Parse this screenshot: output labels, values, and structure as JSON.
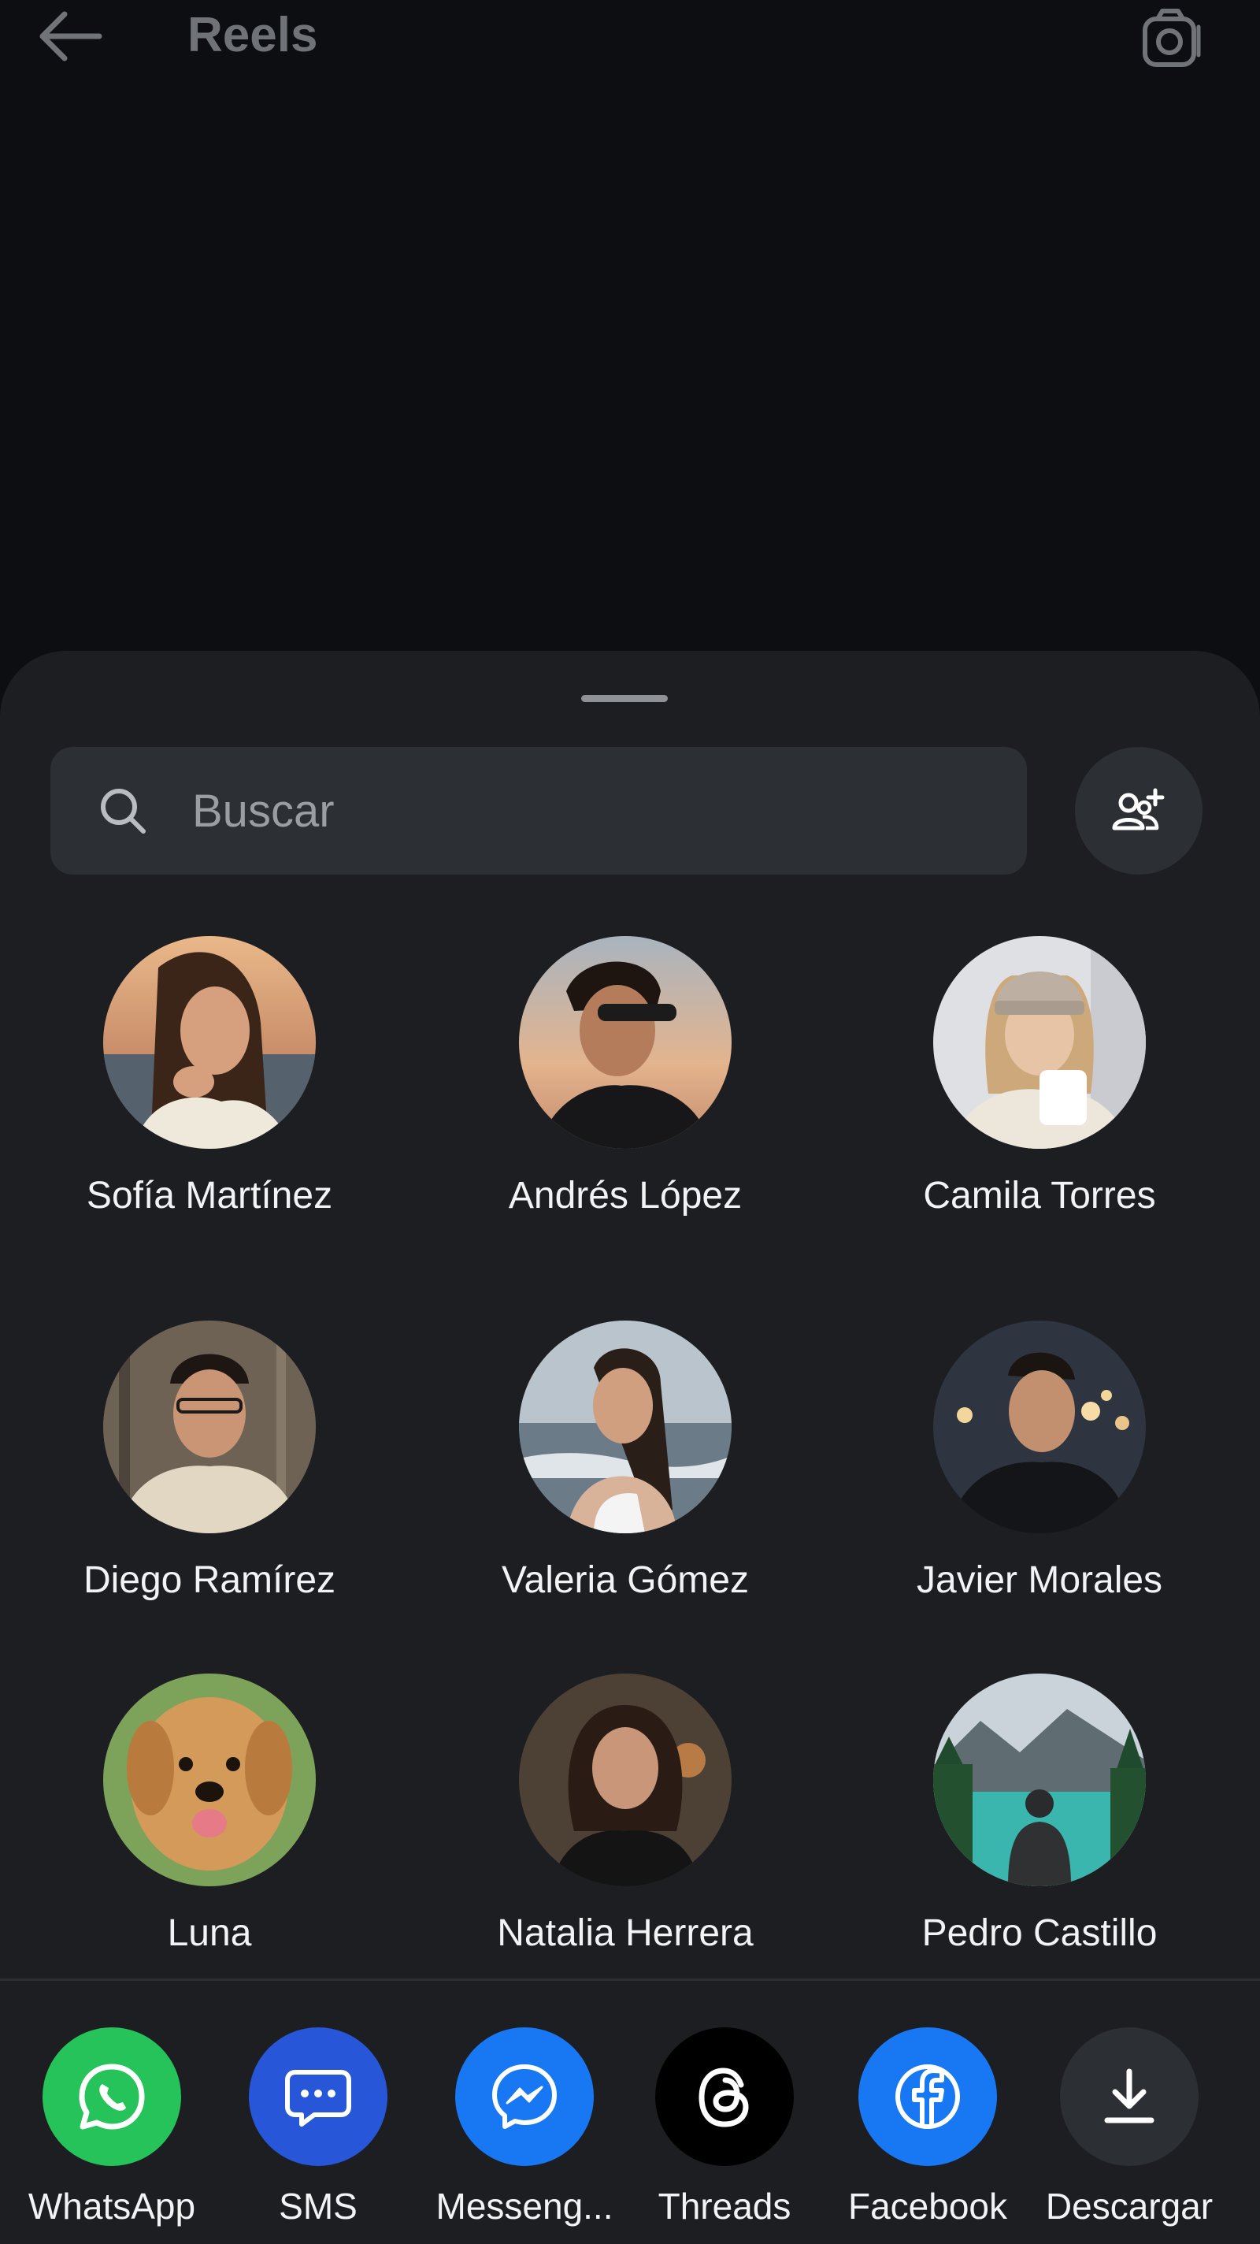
{
  "colors": {
    "background": "#0d0e11",
    "sheet": "#1c1e21",
    "field": "#2c2f33",
    "text_primary": "#f2f3f5",
    "text_dimmed": "#6f7277",
    "whatsapp": "#25c359",
    "sms": "#2856d8",
    "messenger": "#1877f2",
    "threads": "#000000",
    "facebook": "#1877f2",
    "download": "#2c2f33"
  },
  "header": {
    "title": "Reels",
    "back_icon": "arrow-left-icon",
    "camera_icon": "camera-icon"
  },
  "sheet": {
    "search": {
      "placeholder": "Buscar",
      "value": "",
      "icon": "search-icon"
    },
    "add_group_icon": "add-group-icon",
    "contacts": [
      {
        "name": "Sofía Martínez"
      },
      {
        "name": "Andrés López"
      },
      {
        "name": "Camila Torres"
      },
      {
        "name": "Diego Ramírez"
      },
      {
        "name": "Valeria Gómez"
      },
      {
        "name": "Javier Morales"
      },
      {
        "name": "Luna"
      },
      {
        "name": "Natalia Herrera"
      },
      {
        "name": "Pedro Castillo"
      }
    ],
    "share_targets": [
      {
        "label": "WhatsApp",
        "icon": "whatsapp-icon"
      },
      {
        "label": "SMS",
        "icon": "sms-icon"
      },
      {
        "label": "Messeng...",
        "icon": "messenger-icon"
      },
      {
        "label": "Threads",
        "icon": "threads-icon"
      },
      {
        "label": "Facebook",
        "icon": "facebook-icon"
      },
      {
        "label": "Descargar",
        "icon": "download-icon"
      }
    ]
  }
}
